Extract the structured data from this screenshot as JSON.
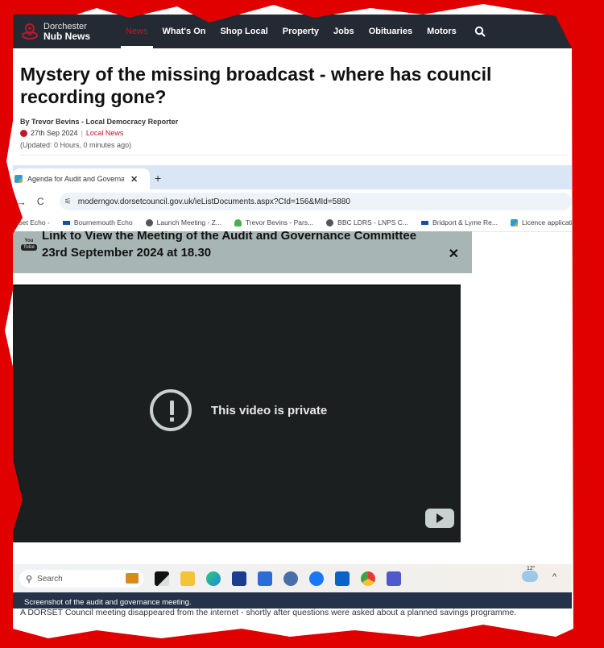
{
  "site": {
    "name_line1": "Dorchester",
    "name_line2": "Nub News",
    "brand_color": "#c0172d"
  },
  "nav": {
    "items": [
      {
        "label": "News",
        "active": true
      },
      {
        "label": "What's On"
      },
      {
        "label": "Shop Local"
      },
      {
        "label": "Property"
      },
      {
        "label": "Jobs"
      },
      {
        "label": "Obituaries"
      },
      {
        "label": "Motors"
      }
    ],
    "search_icon": "search-icon"
  },
  "article": {
    "headline": "Mystery of the missing broadcast - where has council recording gone?",
    "byline": "By Trevor Bevins - Local Democracy Reporter",
    "date": "27th Sep 2024",
    "separator": "|",
    "category": "Local News",
    "updated": "(Updated: 0 Hours, 0 minutes ago)",
    "caption": "Screenshot of the audit and governance meeting.",
    "lede": "A DORSET Council meeting disappeared from the internet - shortly after questions were asked about a planned savings programme."
  },
  "screenshot": {
    "tab_title": "Agenda for Audit and Governance",
    "tab_close": "✕",
    "new_tab": "+",
    "forward_icon": "→",
    "reload_icon": "C",
    "url": "moderngov.dorsetcouncil.gov.uk/ieListDocuments.aspx?CId=156&MId=5880",
    "bookmarks": [
      {
        "label": "orset Echo -",
        "icon": "none"
      },
      {
        "label": "Bournemouth Echo",
        "icon": "echo"
      },
      {
        "label": "Launch Meeting - Z...",
        "icon": "globe"
      },
      {
        "label": "Trevor Bevins - Pars...",
        "icon": "leaf"
      },
      {
        "label": "BBC LDRS - LNPS C...",
        "icon": "globe"
      },
      {
        "label": "Bridport & Lyme Re...",
        "icon": "echo"
      },
      {
        "label": "Licence applicatio",
        "icon": "lic"
      }
    ],
    "banner_text": "Link to View the Meeting of the Audit and Governance Committee 23rd September 2024 at 18.30",
    "banner_yt_you": "You",
    "banner_yt_tube": "Tube",
    "banner_close": "✕",
    "video_message": "This video is private",
    "taskbar": {
      "search_placeholder": "Search",
      "weather_temp": "12°",
      "apps": [
        "task-view",
        "file-explorer",
        "edge",
        "microsoft-store",
        "word",
        "settings",
        "facebook",
        "outlook",
        "chrome",
        "teams"
      ]
    }
  }
}
